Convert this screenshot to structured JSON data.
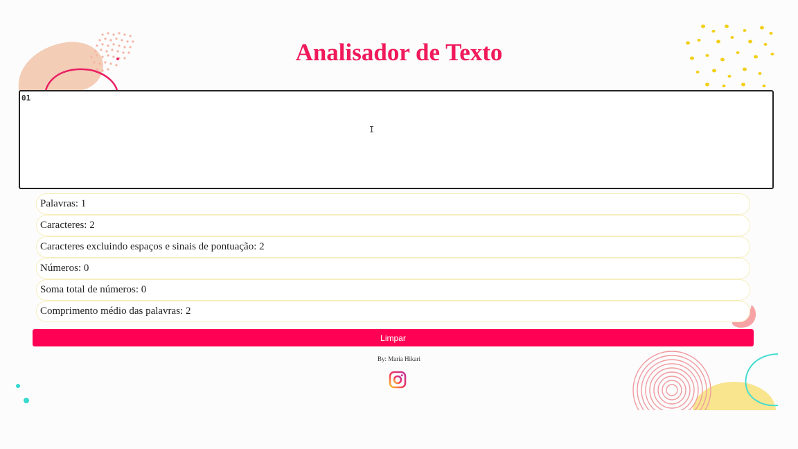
{
  "page": {
    "title": "Analisador de Texto"
  },
  "editor": {
    "value": "01"
  },
  "stats": [
    {
      "label": "Palavras: 1"
    },
    {
      "label": "Caracteres: 2"
    },
    {
      "label": "Caracteres excluindo espaços e sinais de pontuação: 2"
    },
    {
      "label": "Números: 0"
    },
    {
      "label": "Soma total de números: 0"
    },
    {
      "label": "Comprimento médio das palavras: 2"
    }
  ],
  "actions": {
    "clear_label": "Limpar"
  },
  "footer": {
    "credit": "By: Maria Hikari",
    "social_icon": "instagram-icon"
  },
  "colors": {
    "accent": "#f01a5b",
    "button": "#fe0154",
    "stat_border": "#f6efbe"
  }
}
